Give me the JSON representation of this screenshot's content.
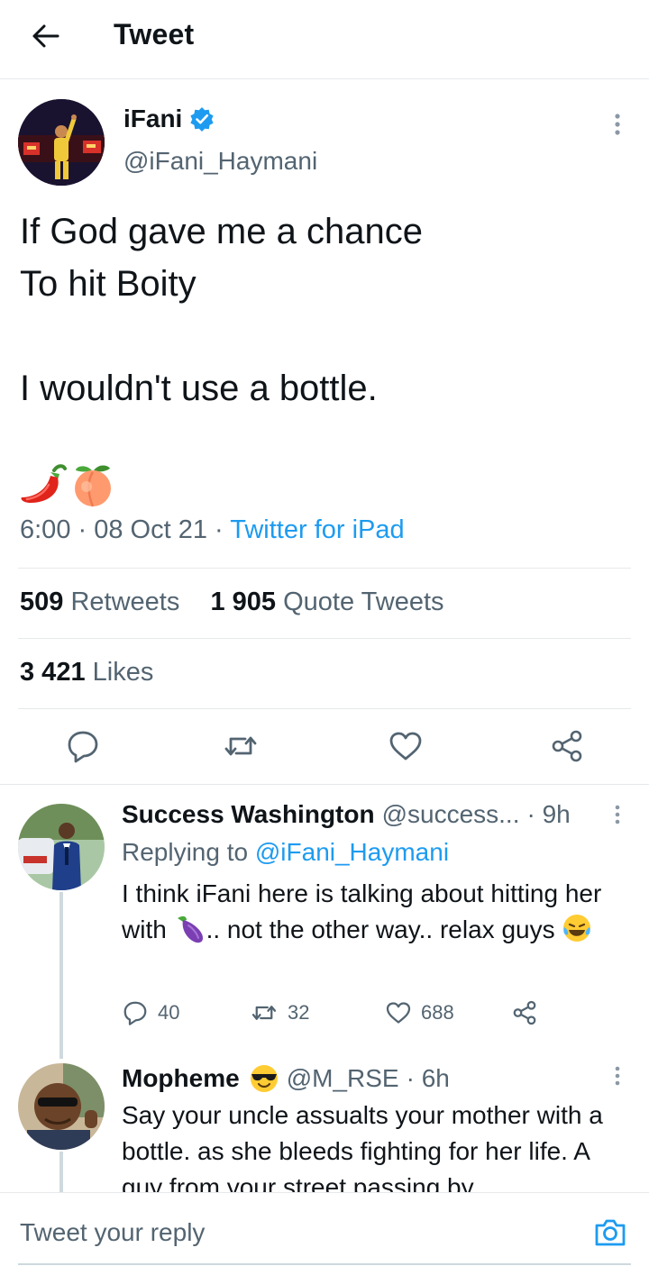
{
  "header": {
    "title": "Tweet",
    "back_icon": "arrow-left-icon"
  },
  "tweet": {
    "author_name": "iFani",
    "author_handle": "@iFani_Haymani",
    "verified": true,
    "text": "If God gave me a chance\nTo hit Boity\n\nI wouldn't use a bottle.",
    "emojis": [
      "hot-pepper-emoji",
      "peach-emoji"
    ],
    "time": "6:00",
    "date": "08 Oct 21",
    "source": "Twitter for iPad",
    "retweets_count": "509",
    "retweets_label": "Retweets",
    "quotes_count": "1 905",
    "quotes_label": "Quote Tweets",
    "likes_count": "3 421",
    "likes_label": "Likes"
  },
  "replies": [
    {
      "name": "Success Washington",
      "handle": "@success...",
      "age": "· 9h",
      "replying_prefix": "Replying to",
      "replying_to": "@iFani_Haymani",
      "text_part1": "I think iFani here is talking about hitting her with",
      "text_part2": ".. not the other way.. relax guys",
      "reply_count": "40",
      "retweet_count": "32",
      "like_count": "688"
    },
    {
      "name": "Mopheme",
      "handle": "@M_RSE",
      "age": "· 6h",
      "text": "Say your uncle assualts your mother with a bottle. as she bleeds fighting for her life. A guy from your street passing by"
    }
  ],
  "reply_bar": {
    "placeholder": "Tweet your reply"
  },
  "colors": {
    "accent": "#1d9bf0",
    "text": "#0f1419",
    "muted": "#536471",
    "divider": "#e6e9eb"
  }
}
